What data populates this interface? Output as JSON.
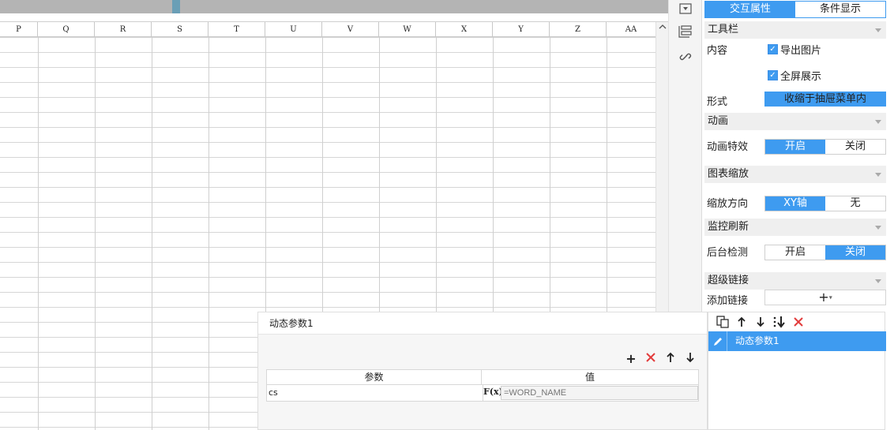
{
  "sheet": {
    "columns": [
      "P",
      "Q",
      "R",
      "S",
      "T",
      "U",
      "V",
      "W",
      "X",
      "Y",
      "Z",
      "AA"
    ]
  },
  "icons": [
    "dropdown-box-icon",
    "layout-icon",
    "link-icon"
  ],
  "panel": {
    "tabs": [
      {
        "label": "交互属性",
        "active": true
      },
      {
        "label": "条件显示",
        "active": false
      }
    ],
    "toolbar_section": "工具栏",
    "content_label": "内容",
    "export_image": "导出图片",
    "fullscreen": "全屏展示",
    "form_label": "形式",
    "form_value": "收缩于抽屉菜单内",
    "animation_section": "动画",
    "animation_effect_label": "动画特效",
    "animation_on": "开启",
    "animation_off": "关闭",
    "zoom_section": "图表缩放",
    "zoom_direction_label": "缩放方向",
    "zoom_xy": "XY轴",
    "zoom_none": "无",
    "refresh_section": "监控刷新",
    "backend_check_label": "后台检测",
    "backend_on": "开启",
    "backend_off": "关闭",
    "hyperlink_section": "超级链接",
    "add_link_label": "添加链接",
    "add_link_button": "+"
  },
  "dialog": {
    "title": "动态参数1",
    "param_header": "参数",
    "value_header": "值",
    "param_name": "cs",
    "fx_label": "F(x)",
    "param_value_placeholder": "=WORD_NAME"
  },
  "param_list": {
    "items": [
      "动态参数1"
    ]
  },
  "colors": {
    "accent": "#3e9bf0",
    "delete": "#e23b3b"
  }
}
